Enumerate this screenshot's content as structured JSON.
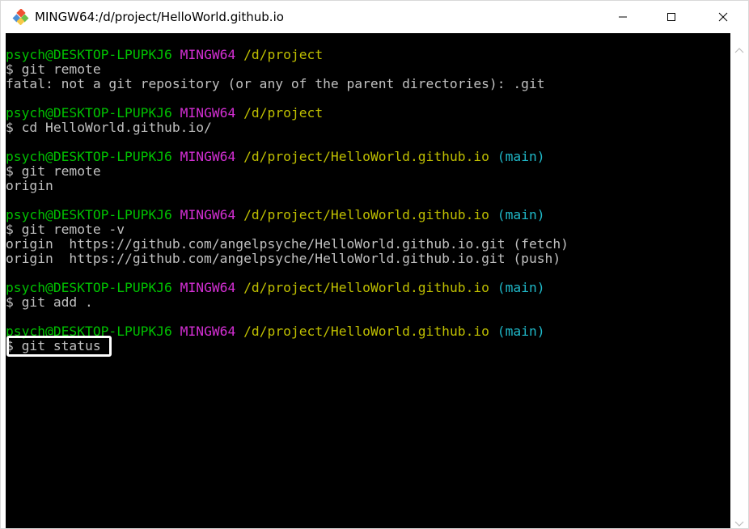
{
  "window": {
    "title": "MINGW64:/d/project/HelloWorld.github.io",
    "icon": "git-bash-icon",
    "controls": {
      "minimize": "minimize-icon",
      "maximize": "maximize-icon",
      "close": "close-icon"
    }
  },
  "colors": {
    "user": "#00c000",
    "shell": "#d42fd4",
    "path": "#bfbf00",
    "branch": "#1fb8c8",
    "text": "#c0c0c0",
    "background": "#000000"
  },
  "terminal": {
    "blocks": [
      {
        "prompt": {
          "user": "psych@DESKTOP-LPUPKJ6",
          "shell": "MINGW64",
          "path": "/d/project",
          "branch": ""
        },
        "command": "$ git remote",
        "output": [
          "fatal: not a git repository (or any of the parent directories): .git"
        ]
      },
      {
        "prompt": {
          "user": "psych@DESKTOP-LPUPKJ6",
          "shell": "MINGW64",
          "path": "/d/project",
          "branch": ""
        },
        "command": "$ cd HelloWorld.github.io/",
        "output": []
      },
      {
        "prompt": {
          "user": "psych@DESKTOP-LPUPKJ6",
          "shell": "MINGW64",
          "path": "/d/project/HelloWorld.github.io",
          "branch": "(main)"
        },
        "command": "$ git remote",
        "output": [
          "origin"
        ]
      },
      {
        "prompt": {
          "user": "psych@DESKTOP-LPUPKJ6",
          "shell": "MINGW64",
          "path": "/d/project/HelloWorld.github.io",
          "branch": "(main)"
        },
        "command": "$ git remote -v",
        "output": [
          "origin  https://github.com/angelpsyche/HelloWorld.github.io.git (fetch)",
          "origin  https://github.com/angelpsyche/HelloWorld.github.io.git (push)"
        ]
      },
      {
        "prompt": {
          "user": "psych@DESKTOP-LPUPKJ6",
          "shell": "MINGW64",
          "path": "/d/project/HelloWorld.github.io",
          "branch": "(main)"
        },
        "command": "$ git add .",
        "output": []
      },
      {
        "prompt": {
          "user": "psych@DESKTOP-LPUPKJ6",
          "shell": "MINGW64",
          "path": "/d/project/HelloWorld.github.io",
          "branch": "(main)"
        },
        "command": "$ git status",
        "output": [],
        "highlighted": true,
        "last": true
      }
    ]
  }
}
